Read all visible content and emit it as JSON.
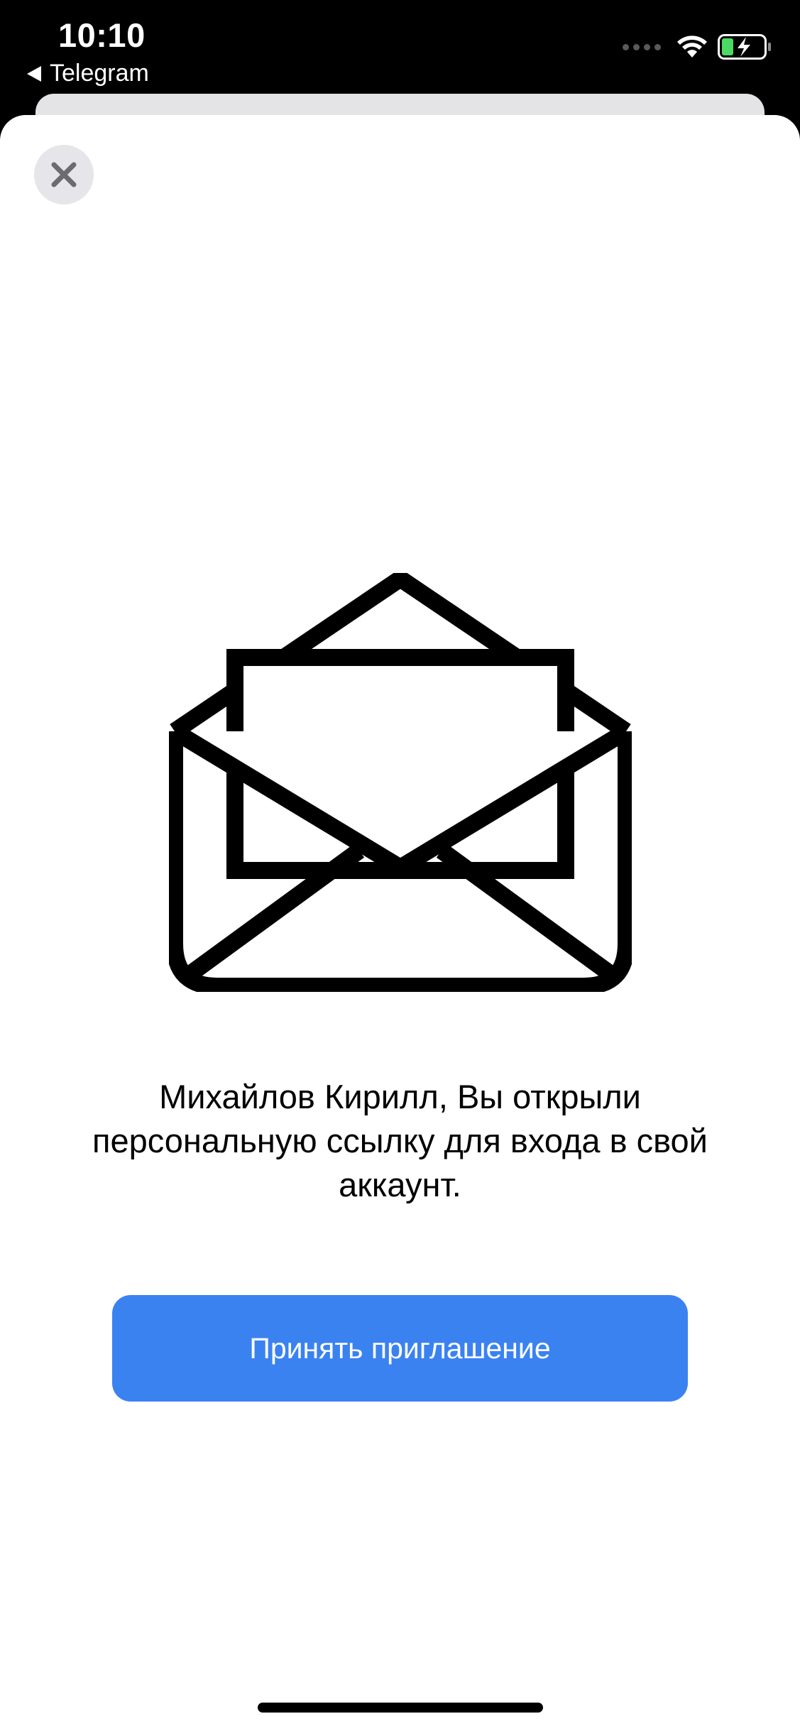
{
  "status_bar": {
    "time": "10:10",
    "back_app": "Telegram",
    "battery_color": "#4cd964",
    "signal_icon": "cellular-signal-icon",
    "wifi_icon": "wifi-icon",
    "battery_icon": "battery-charging-icon"
  },
  "sheet": {
    "close_icon": "close-icon",
    "illustration_icon": "open-envelope-icon",
    "message": "Михайлов Кирилл, Вы открыли персональную ссылку для входа в свой аккаунт.",
    "accept_label": "Принять приглашение",
    "accent_color": "#3b82f1"
  }
}
